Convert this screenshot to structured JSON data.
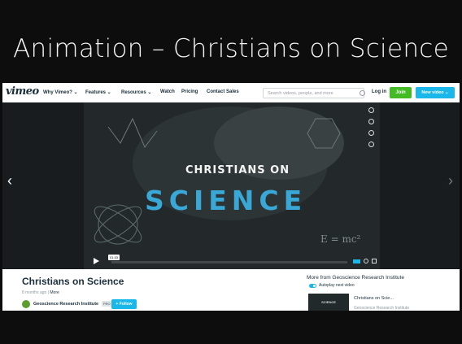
{
  "slide": {
    "title": "Animation – Christians on Science"
  },
  "nav": {
    "logo": "vimeo",
    "items": [
      "Why Vimeo? ⌄",
      "Features ⌄",
      "Resources ⌄",
      "Watch",
      "Pricing",
      "Contact Sales"
    ],
    "search_placeholder": "Search videos, people, and more",
    "login": "Log in",
    "join": "Join",
    "new_video": "New video ⌄"
  },
  "player": {
    "time": "01:33",
    "left_arrow": "‹",
    "right_arrow": "›",
    "video_line1": "CHRISTIANS ON",
    "video_line2": "SCIENCE",
    "formula": "E = mc²"
  },
  "video_info": {
    "title": "Christians on Science",
    "ago": "8 months ago",
    "more": "More",
    "owner": "Geoscience Research Institute",
    "badge": "PRO",
    "follow": "+ Follow"
  },
  "related": {
    "heading": "More from Geoscience Research Institute",
    "autoplay": "Autoplay next video",
    "thumb_label": "SCIENCE",
    "item_title": "Christians on Scie...",
    "item_owner": "Geoscience Research Institute"
  },
  "colors": {
    "accent": "#1ab7ea",
    "join": "#44bb25",
    "dark": "#1a2e3b"
  }
}
